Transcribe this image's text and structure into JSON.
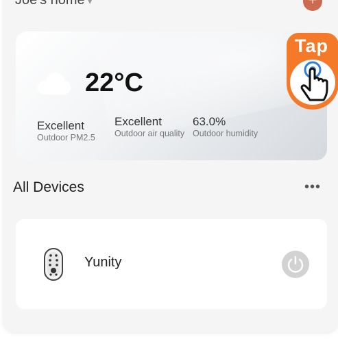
{
  "header": {
    "home_name": "Joe's home",
    "caret": "▾",
    "add_symbol": "+"
  },
  "weather": {
    "icon": "cloud-icon",
    "temperature": "22°C",
    "stats": [
      {
        "value": "Excellent",
        "label": "Outdoor PM2.5"
      },
      {
        "value": "Excellent",
        "label": "Outdoor air quality"
      },
      {
        "value": "63.0%",
        "label": "Outdoor humidity"
      }
    ]
  },
  "devices_section": {
    "title": "All Devices",
    "more": "•••"
  },
  "devices": [
    {
      "name": "Yunity",
      "icon": "smart-lock-icon",
      "power_icon": "power-icon"
    }
  ],
  "overlay": {
    "tap_label": "Tap",
    "icon": "hand-tap-icon",
    "color": "#f47a2a"
  }
}
